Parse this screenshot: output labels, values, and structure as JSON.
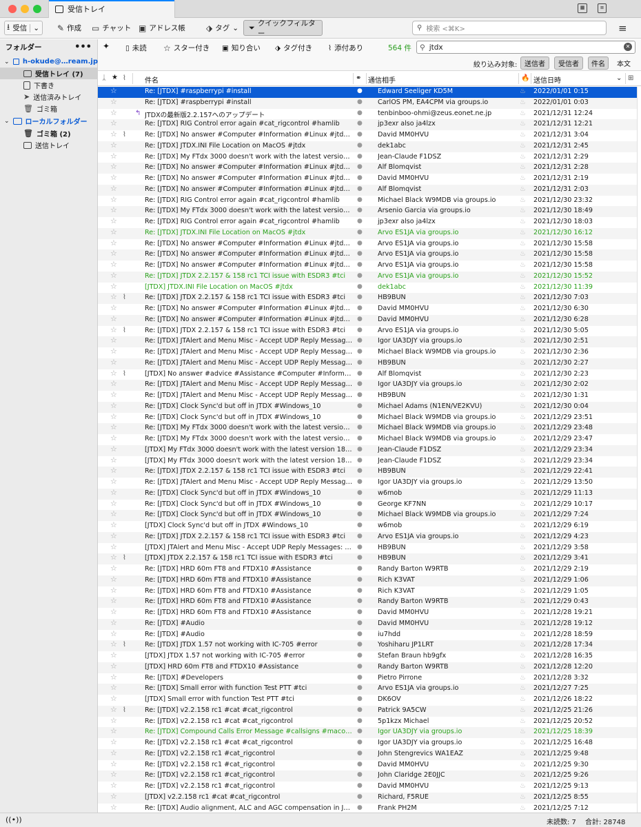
{
  "window": {
    "title": "受信トレイ"
  },
  "toolbar": {
    "get_mail": "受信",
    "write": "作成",
    "chat": "チャット",
    "address_book": "アドレス帳",
    "tag": "タグ",
    "quick_filter": "クイックフィルター",
    "search_placeholder": "検索 <⌘K>"
  },
  "sidebar": {
    "header": "フォルダー",
    "account": "h-okude@…ream.jp",
    "folders": [
      {
        "label": "受信トレイ (7)",
        "selected": true
      },
      {
        "label": "下書き"
      },
      {
        "label": "送信済みトレイ"
      },
      {
        "label": "ゴミ箱"
      }
    ],
    "local": "ローカルフォルダー",
    "local_folders": [
      {
        "label": "ゴミ箱 (2)",
        "bold": true
      },
      {
        "label": "送信トレイ"
      }
    ]
  },
  "quickfilter": {
    "unread": "未読",
    "starred": "スター付き",
    "contacts": "知り合い",
    "tagged": "タグ付き",
    "attachment": "添付あり",
    "count": "564 件",
    "search_value": "jtdx",
    "filter_label": "絞り込み対象:",
    "sender": "送信者",
    "recipient": "受信者",
    "subject": "件名",
    "body": "本文"
  },
  "columns": {
    "subject": "件名",
    "from": "通信相手",
    "date": "送信日時"
  },
  "messages": [
    {
      "subject": "Re: [JTDX] #raspberrypi #install",
      "from": "Edward Seeliger KD5M",
      "date": "2022/01/01 0:15",
      "selected": true
    },
    {
      "subject": "Re: [JTDX] #raspberrypi #install",
      "from": "CarlOS PM, EA4CPM via groups.io",
      "date": "2022/01/01 0:03"
    },
    {
      "subject": "JTDXの最新版2.2.157へのアップデート",
      "from": "tenbinboo-ohmi@zeus.eonet.ne.jp",
      "date": "2021/12/31 12:24",
      "thread": true
    },
    {
      "subject": "Re: [JTDX] RIG Control error again #cat_rigcontrol #hamlib",
      "from": "jp3exr also ja4lzx",
      "date": "2021/12/31 12:21"
    },
    {
      "subject": "Re: [JTDX] No answer #Computer #Information #Linux #jtdx #ra…",
      "from": "David MM0HVU",
      "date": "2021/12/31 3:04",
      "att": true
    },
    {
      "subject": "Re: [JTDX] JTDX.INI File Location on MacOS #jtdx",
      "from": "dek1abc",
      "date": "2021/12/31 2:45"
    },
    {
      "subject": "Re: [JTDX] My FTdx 3000 doesn't work with the latest version 1…",
      "from": "Jean-Claude F1DSZ",
      "date": "2021/12/31 2:29"
    },
    {
      "subject": "Re: [JTDX] No answer #Computer #Information #Linux #jtdx #ra…",
      "from": "Alf Blomqvist",
      "date": "2021/12/31 2:28"
    },
    {
      "subject": "Re: [JTDX] No answer #Computer #Information #Linux #jtdx #ra…",
      "from": "David MM0HVU",
      "date": "2021/12/31 2:19"
    },
    {
      "subject": "Re: [JTDX] No answer #Computer #Information #Linux #jtdx #ra…",
      "from": "Alf Blomqvist",
      "date": "2021/12/31 2:03"
    },
    {
      "subject": "Re: [JTDX] RIG Control error again #cat_rigcontrol #hamlib",
      "from": "Michael Black W9MDB via groups.io",
      "date": "2021/12/30 23:32"
    },
    {
      "subject": "Re: [JTDX] My FTdx 3000 doesn't work with the latest version 1…",
      "from": "Arsenio Garcia via groups.io",
      "date": "2021/12/30 18:49"
    },
    {
      "subject": "Re: [JTDX] RIG Control error again #cat_rigcontrol #hamlib",
      "from": "jp3exr also ja4lzx",
      "date": "2021/12/30 18:03"
    },
    {
      "subject": "Re: [JTDX] JTDX.INI File Location on MacOS #jtdx",
      "from": "Arvo ES1JA via groups.io",
      "date": "2021/12/30 16:12",
      "green": true
    },
    {
      "subject": "Re: [JTDX] No answer #Computer #Information #Linux #jtdx #ra…",
      "from": "Arvo ES1JA via groups.io",
      "date": "2021/12/30 15:58"
    },
    {
      "subject": "Re: [JTDX] No answer #Computer #Information #Linux #jtdx #ra…",
      "from": "Arvo ES1JA via groups.io",
      "date": "2021/12/30 15:58"
    },
    {
      "subject": "Re: [JTDX] No answer #Computer #Information #Linux #jtdx #ra…",
      "from": "Arvo ES1JA via groups.io",
      "date": "2021/12/30 15:58"
    },
    {
      "subject": "Re: [JTDX] JTDX 2.2.157 & 158 rc1 TCI issue with ESDR3 #tci",
      "from": "Arvo ES1JA via groups.io",
      "date": "2021/12/30 15:52",
      "green": true
    },
    {
      "subject": "[JTDX] JTDX.INI File Location on MacOS #jtdx",
      "from": "dek1abc",
      "date": "2021/12/30 11:39",
      "green": true
    },
    {
      "subject": "Re: [JTDX] JTDX 2.2.157 & 158 rc1 TCI issue with ESDR3 #tci",
      "from": "HB9BUN",
      "date": "2021/12/30 7:03",
      "att": true
    },
    {
      "subject": "Re: [JTDX] No answer #Computer #Information #Linux #jtdx #ra…",
      "from": "David MM0HVU",
      "date": "2021/12/30 6:30"
    },
    {
      "subject": "Re: [JTDX] No answer #Computer #Information #Linux #jtdx #ra…",
      "from": "David MM0HVU",
      "date": "2021/12/30 6:28"
    },
    {
      "subject": "Re: [JTDX] JTDX 2.2.157 & 158 rc1 TCI issue with ESDR3 #tci",
      "from": "Arvo ES1JA via groups.io",
      "date": "2021/12/30 5:05",
      "att": true
    },
    {
      "subject": "Re: [JTDX] JTAlert and Menu Misc - Accept UDP Reply Messag…",
      "from": "Igor UA3DJY via groups.io",
      "date": "2021/12/30 2:51"
    },
    {
      "subject": "Re: [JTDX] JTAlert and Menu Misc - Accept UDP Reply Messag…",
      "from": "Michael Black W9MDB via groups.io",
      "date": "2021/12/30 2:36"
    },
    {
      "subject": "Re: [JTDX] JTAlert and Menu Misc - Accept UDP Reply Messag…",
      "from": "HB9BUN",
      "date": "2021/12/30 2:27"
    },
    {
      "subject": "[JTDX] No answer #advice #Assistance #Computer #Informatio…",
      "from": "Alf Blomqvist",
      "date": "2021/12/30 2:23",
      "att": true
    },
    {
      "subject": "Re: [JTDX] JTAlert and Menu Misc - Accept UDP Reply Messag…",
      "from": "Igor UA3DJY via groups.io",
      "date": "2021/12/30 2:02"
    },
    {
      "subject": "Re: [JTDX] JTAlert and Menu Misc - Accept UDP Reply Messag…",
      "from": "HB9BUN",
      "date": "2021/12/30 1:31"
    },
    {
      "subject": "Re: [JTDX] Clock Sync'd but off in JTDX #Windows_10",
      "from": "Michael Adams (N1EN/VE2KVU)",
      "date": "2021/12/30 0:04"
    },
    {
      "subject": "Re: [JTDX] Clock Sync'd but off in JTDX #Windows_10",
      "from": "Michael Black W9MDB via groups.io",
      "date": "2021/12/29 23:51"
    },
    {
      "subject": "Re: [JTDX] My FTdx 3000 doesn't work with the latest version 1…",
      "from": "Michael Black W9MDB via groups.io",
      "date": "2021/12/29 23:48"
    },
    {
      "subject": "Re: [JTDX] My FTdx 3000 doesn't work with the latest version 1…",
      "from": "Michael Black W9MDB via groups.io",
      "date": "2021/12/29 23:47"
    },
    {
      "subject": "[JTDX] My FTdx 3000 doesn't work with the latest version 185 r…",
      "from": "Jean-Claude F1DSZ",
      "date": "2021/12/29 23:34"
    },
    {
      "subject": "[JTDX] My FTdx 3000 doesn't work with the latest version 185 r…",
      "from": "Jean-Claude F1DSZ",
      "date": "2021/12/29 23:34"
    },
    {
      "subject": "Re: [JTDX] JTDX 2.2.157 & 158 rc1 TCI issue with ESDR3 #tci",
      "from": "HB9BUN",
      "date": "2021/12/29 22:41"
    },
    {
      "subject": "Re: [JTDX] JTAlert and Menu Misc - Accept UDP Reply Messag…",
      "from": "Igor UA3DJY via groups.io",
      "date": "2021/12/29 13:50"
    },
    {
      "subject": "Re: [JTDX] Clock Sync'd but off in JTDX #Windows_10",
      "from": "w6mob",
      "date": "2021/12/29 11:13"
    },
    {
      "subject": "Re: [JTDX] Clock Sync'd but off in JTDX #Windows_10",
      "from": "George KF7NN",
      "date": "2021/12/29 10:17"
    },
    {
      "subject": "Re: [JTDX] Clock Sync'd but off in JTDX #Windows_10",
      "from": "Michael Black W9MDB via groups.io",
      "date": "2021/12/29 7:24"
    },
    {
      "subject": "[JTDX] Clock Sync'd but off in JTDX #Windows_10",
      "from": "w6mob",
      "date": "2021/12/29 6:19"
    },
    {
      "subject": "Re: [JTDX] JTDX 2.2.157 & 158 rc1 TCI issue with ESDR3 #tci",
      "from": "Arvo ES1JA via groups.io",
      "date": "2021/12/29 4:23"
    },
    {
      "subject": "[JTDX] JTAlert and Menu Misc - Accept UDP Reply Messages: \"…",
      "from": "HB9BUN",
      "date": "2021/12/29 3:58"
    },
    {
      "subject": "[JTDX] JTDX 2.2.157 & 158 rc1 TCI issue with ESDR3 #tci",
      "from": "HB9BUN",
      "date": "2021/12/29 3:41",
      "att": true
    },
    {
      "subject": "Re: [JTDX] HRD 60m FT8 and FTDX10 #Assistance",
      "from": "Randy Barton W9RTB",
      "date": "2021/12/29 2:19"
    },
    {
      "subject": "Re: [JTDX] HRD 60m FT8 and FTDX10 #Assistance",
      "from": "Rich K3VAT",
      "date": "2021/12/29 1:06"
    },
    {
      "subject": "Re: [JTDX] HRD 60m FT8 and FTDX10 #Assistance",
      "from": "Rich K3VAT",
      "date": "2021/12/29 1:05"
    },
    {
      "subject": "Re: [JTDX] HRD 60m FT8 and FTDX10 #Assistance",
      "from": "Randy Barton W9RTB",
      "date": "2021/12/29 0:43"
    },
    {
      "subject": "Re: [JTDX] HRD 60m FT8 and FTDX10 #Assistance",
      "from": "David MM0HVU",
      "date": "2021/12/28 19:21"
    },
    {
      "subject": "Re: [JTDX] #Audio",
      "from": "David MM0HVU",
      "date": "2021/12/28 19:12"
    },
    {
      "subject": "Re: [JTDX] #Audio",
      "from": "iu7hdd",
      "date": "2021/12/28 18:59"
    },
    {
      "subject": "Re: [JTDX] JTDX 1.57 not working with IC-705 #error",
      "from": "Yoshiharu JP1LRT",
      "date": "2021/12/28 17:34",
      "att": true
    },
    {
      "subject": "[JTDX] JTDX 1.57 not working with IC-705 #error",
      "from": "Stefan Braun hb9gfx",
      "date": "2021/12/28 16:35"
    },
    {
      "subject": "[JTDX] HRD 60m FT8 and FTDX10 #Assistance",
      "from": "Randy Barton W9RTB",
      "date": "2021/12/28 12:20"
    },
    {
      "subject": "Re: [JTDX] #Developers",
      "from": "Pietro Pirrone",
      "date": "2021/12/28 3:32"
    },
    {
      "subject": "Re: [JTDX] Small error with function Test PTT #tci",
      "from": "Arvo ES1JA via groups.io",
      "date": "2021/12/27 7:25"
    },
    {
      "subject": "[JTDX] Small error with function Test PTT #tci",
      "from": "DK6OV",
      "date": "2021/12/26 18:22"
    },
    {
      "subject": "Re: [JTDX] v2.2.158 rc1 #cat #cat_rigcontrol",
      "from": "Patrick 9A5CW",
      "date": "2021/12/25 21:26",
      "att": true
    },
    {
      "subject": "Re: [JTDX] v2.2.158 rc1 #cat #cat_rigcontrol",
      "from": "5p1kzx Michael",
      "date": "2021/12/25 20:52"
    },
    {
      "subject": "Re: [JTDX] Compound Calls Error Message #callsigns #macos #…",
      "from": "Igor UA3DJY via groups.io",
      "date": "2021/12/25 18:39",
      "green": true
    },
    {
      "subject": "Re: [JTDX] v2.2.158 rc1 #cat #cat_rigcontrol",
      "from": "Igor UA3DJY via groups.io",
      "date": "2021/12/25 16:48"
    },
    {
      "subject": "Re: [JTDX] v2.2.158 rc1 #cat_rigcontrol",
      "from": "John Stengrevics WA1EAZ",
      "date": "2021/12/25 9:48"
    },
    {
      "subject": "Re: [JTDX] v2.2.158 rc1 #cat_rigcontrol",
      "from": "David MM0HVU",
      "date": "2021/12/25 9:30"
    },
    {
      "subject": "Re: [JTDX] v2.2.158 rc1 #cat_rigcontrol",
      "from": "John Claridge 2E0JJC",
      "date": "2021/12/25 9:26"
    },
    {
      "subject": "Re: [JTDX] v2.2.158 rc1 #cat_rigcontrol",
      "from": "David MM0HVU",
      "date": "2021/12/25 9:13"
    },
    {
      "subject": "[JTDX] v2.2.158 rc1 #cat #cat_rigcontrol",
      "from": "Richard, F5RUE",
      "date": "2021/12/25 8:55"
    },
    {
      "subject": "Re: [JTDX] Audio alignment, ALC and AGC compensation in JTD…",
      "from": "Frank PH2M",
      "date": "2021/12/25 7:12"
    }
  ],
  "status": {
    "unread": "未読数: 7",
    "total": "合計: 28748"
  }
}
